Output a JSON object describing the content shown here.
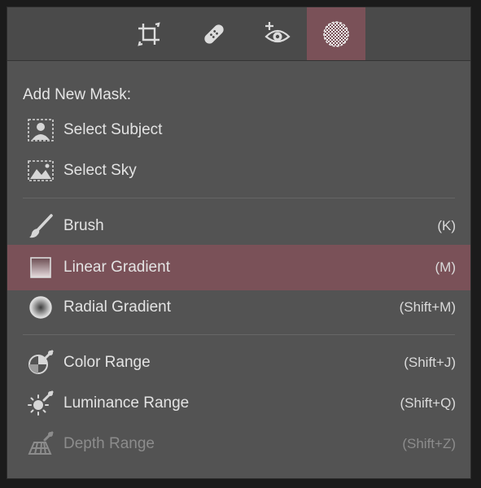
{
  "toolbar": {
    "tools": [
      {
        "icon": "crop-icon",
        "active": false
      },
      {
        "icon": "healing-bandage-icon",
        "active": false
      },
      {
        "icon": "red-eye-icon",
        "active": false
      },
      {
        "icon": "masking-icon",
        "active": true
      }
    ]
  },
  "menu": {
    "heading": "Add New Mask:",
    "ai_items": [
      {
        "label": "Select Subject",
        "icon": "subject-icon"
      },
      {
        "label": "Select Sky",
        "icon": "sky-icon"
      }
    ],
    "tool_items": [
      {
        "label": "Brush",
        "shortcut": "(K)",
        "icon": "brush-icon"
      },
      {
        "label": "Linear Gradient",
        "shortcut": "(M)",
        "icon": "linear-gradient-icon"
      },
      {
        "label": "Radial Gradient",
        "shortcut": "(Shift+M)",
        "icon": "radial-gradient-icon"
      }
    ],
    "range_items": [
      {
        "label": "Color Range",
        "shortcut": "(Shift+J)",
        "icon": "color-range-icon"
      },
      {
        "label": "Luminance Range",
        "shortcut": "(Shift+Q)",
        "icon": "luminance-range-icon"
      },
      {
        "label": "Depth Range",
        "shortcut": "(Shift+Z)",
        "icon": "depth-range-icon",
        "disabled": true
      }
    ]
  },
  "colors": {
    "panel_bg": "#535353",
    "highlight": "#7a5158",
    "text": "#e3e3e3",
    "disabled_text": "#8c8c8c"
  }
}
